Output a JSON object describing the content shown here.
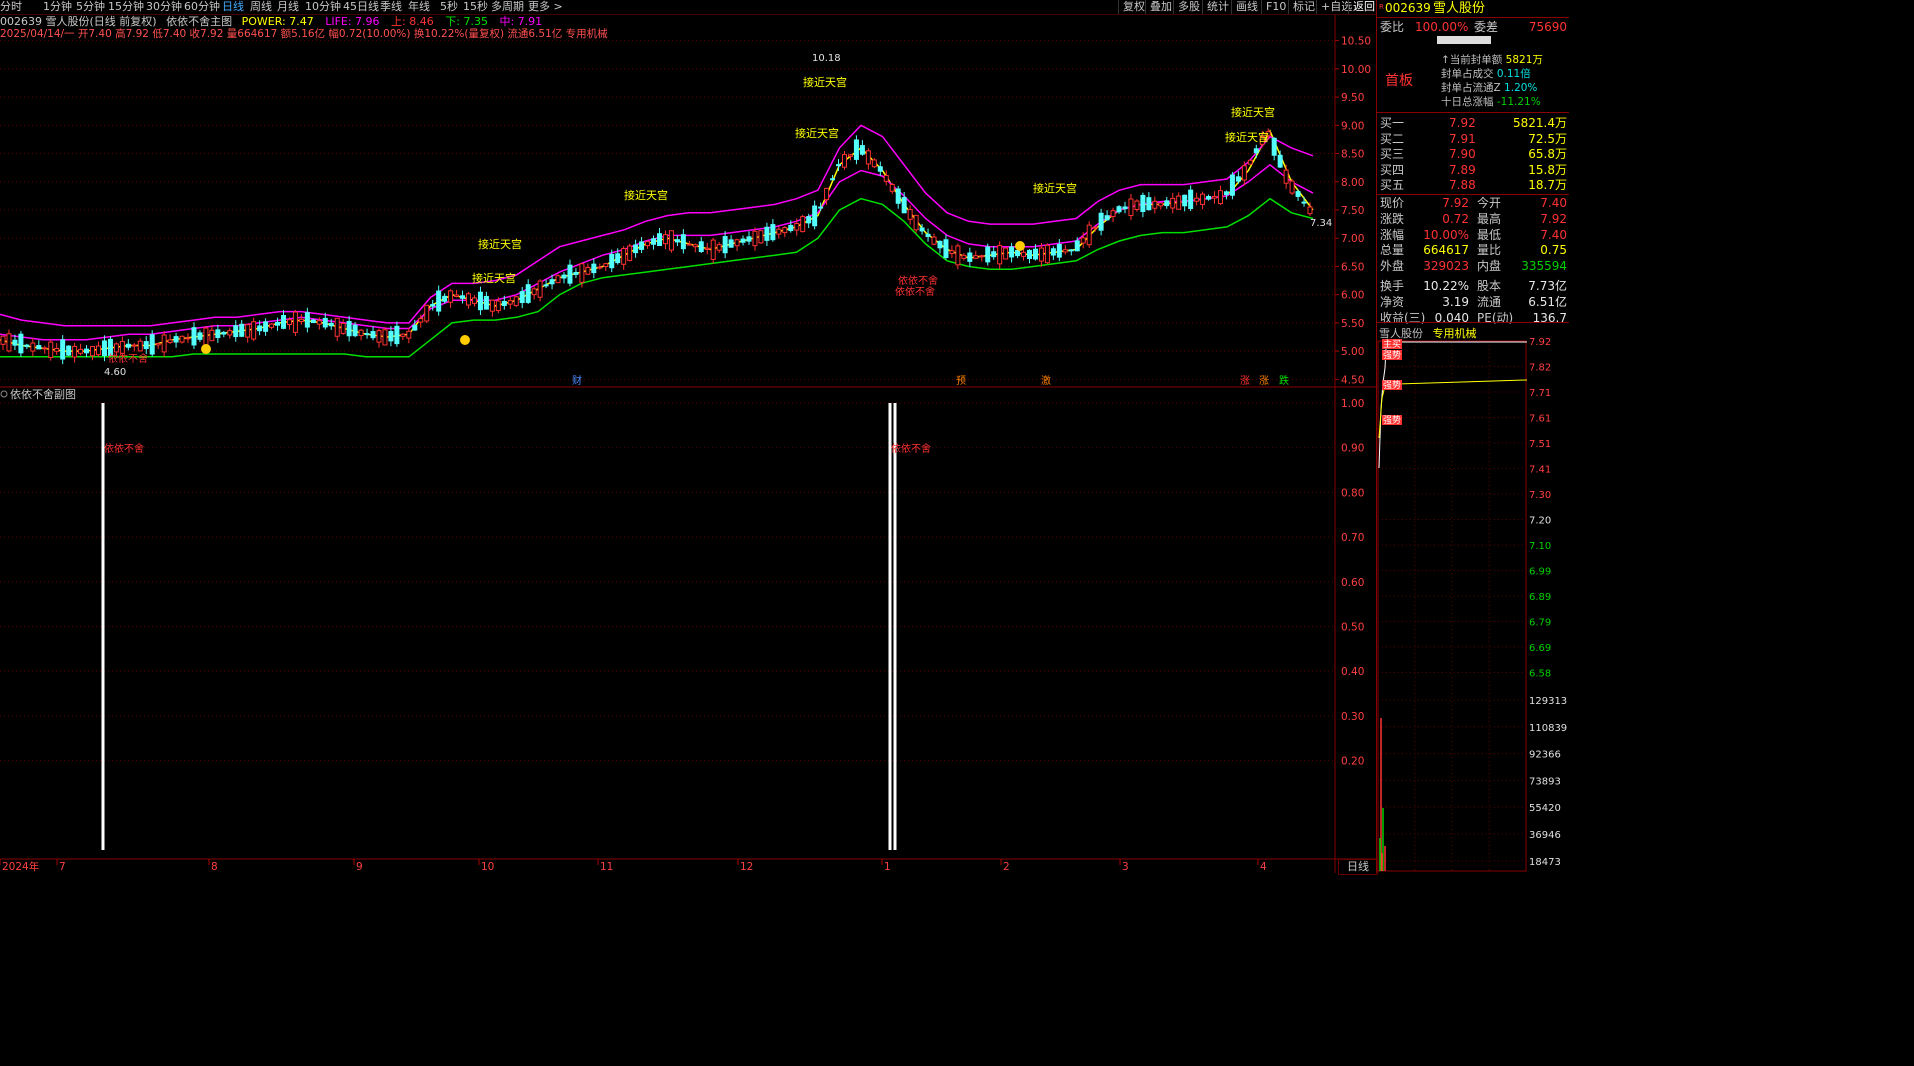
{
  "topbar": {
    "periods": [
      "分时",
      "1分钟",
      "5分钟",
      "15分钟",
      "30分钟",
      "60分钟",
      "日线",
      "周线",
      "月线",
      "10分钟",
      "45日线",
      "季线",
      "年线",
      "5秒",
      "15秒",
      "多周期",
      "更多 >"
    ],
    "selected": "日线",
    "tools": [
      "复权",
      "叠加",
      "多股",
      "统计",
      "画线",
      "F10",
      "标记",
      "+自选",
      "返回"
    ]
  },
  "header": {
    "stock_title": "002639 雪人股份(日线 前复权)",
    "indicator_name": "依依不舍主图",
    "power": "POWER: 7.47",
    "life": "LIFE: 7.96",
    "up": "上: 8.46",
    "down": "下: 7.35",
    "mid": "中: 7.91",
    "bar_info": "2025/04/14/一 开7.40 高7.92 低7.40 收7.92 量664617 额5.16亿 幅0.72(10.00%) 换10.22%(量复权) 流通6.51亿 专用机械"
  },
  "colors": {
    "up": "#ff3232",
    "down": "#54ffff",
    "power": "#ffff00",
    "life": "#ff00ff",
    "upper": "#ff00ff",
    "lower": "#00e000",
    "accent": "#ff3232"
  },
  "chart_data": [
    {
      "type": "candlestick",
      "title": "依依不舍主图",
      "x_labels": [
        "2024年",
        "7",
        "8",
        "9",
        "10",
        "11",
        "12",
        "1",
        "2",
        "3",
        "4"
      ],
      "y_ticks": [
        "10.50",
        "10.00",
        "9.50",
        "9.00",
        "8.50",
        "8.00",
        "7.50",
        "7.00",
        "6.50",
        "6.00",
        "5.50",
        "5.00",
        "4.50"
      ],
      "ylim": [
        4.4,
        10.6
      ],
      "annotations": [
        "10.18",
        "4.60",
        "7.34",
        "接近天宫",
        "依依不舍",
        "财",
        "预",
        "激",
        "涨",
        "跌"
      ],
      "series": [
        {
          "name": "POWER",
          "values": [
            5.2,
            5.1,
            5.05,
            5.0,
            5.0,
            5.05,
            5.1,
            5.1,
            5.2,
            5.25,
            5.3,
            5.35,
            5.4,
            5.5,
            5.55,
            5.5,
            5.4,
            5.3,
            5.25,
            5.3,
            5.8,
            6.0,
            5.9,
            5.8,
            5.9,
            6.1,
            6.3,
            6.4,
            6.5,
            6.7,
            6.9,
            7.0,
            6.9,
            6.8,
            6.9,
            7.0,
            7.1,
            7.2,
            7.4,
            8.3,
            8.6,
            8.2,
            7.6,
            7.1,
            6.8,
            6.65,
            6.7,
            6.75,
            6.7,
            6.75,
            6.8,
            7.2,
            7.5,
            7.6,
            7.6,
            7.65,
            7.7,
            7.75,
            8.2,
            8.9,
            8.0,
            7.5
          ]
        },
        {
          "name": "LIFE",
          "values": [
            5.3,
            5.25,
            5.2,
            5.2,
            5.2,
            5.25,
            5.3,
            5.3,
            5.35,
            5.4,
            5.45,
            5.45,
            5.5,
            5.55,
            5.6,
            5.55,
            5.5,
            5.45,
            5.4,
            5.4,
            5.75,
            5.9,
            5.9,
            5.9,
            6.0,
            6.2,
            6.4,
            6.55,
            6.7,
            6.8,
            6.95,
            7.05,
            7.05,
            7.05,
            7.1,
            7.15,
            7.2,
            7.3,
            7.45,
            8.0,
            8.2,
            8.1,
            7.75,
            7.35,
            7.05,
            6.9,
            6.85,
            6.85,
            6.85,
            6.9,
            6.95,
            7.25,
            7.5,
            7.6,
            7.65,
            7.65,
            7.7,
            7.75,
            8.0,
            8.3,
            8.0,
            7.8
          ]
        },
        {
          "name": "上",
          "values": [
            5.65,
            5.55,
            5.5,
            5.45,
            5.45,
            5.45,
            5.45,
            5.45,
            5.5,
            5.55,
            5.6,
            5.6,
            5.65,
            5.7,
            5.7,
            5.65,
            5.6,
            5.55,
            5.5,
            5.5,
            5.95,
            6.2,
            6.2,
            6.25,
            6.35,
            6.6,
            6.85,
            6.95,
            7.05,
            7.15,
            7.3,
            7.4,
            7.45,
            7.45,
            7.5,
            7.55,
            7.6,
            7.7,
            7.85,
            8.6,
            9.0,
            8.8,
            8.3,
            7.8,
            7.45,
            7.3,
            7.25,
            7.25,
            7.25,
            7.3,
            7.35,
            7.65,
            7.85,
            7.95,
            7.95,
            7.95,
            8.0,
            8.05,
            8.35,
            8.8,
            8.6,
            8.46
          ]
        },
        {
          "name": "下",
          "values": [
            4.9,
            4.9,
            4.9,
            4.9,
            4.9,
            4.9,
            4.9,
            4.9,
            4.9,
            4.95,
            4.95,
            4.95,
            4.95,
            4.95,
            4.95,
            4.95,
            4.95,
            4.9,
            4.9,
            4.9,
            5.2,
            5.5,
            5.55,
            5.55,
            5.6,
            5.7,
            6.0,
            6.2,
            6.3,
            6.35,
            6.4,
            6.45,
            6.5,
            6.55,
            6.6,
            6.65,
            6.7,
            6.75,
            7.0,
            7.5,
            7.7,
            7.6,
            7.3,
            6.9,
            6.6,
            6.5,
            6.45,
            6.45,
            6.5,
            6.55,
            6.6,
            6.8,
            6.95,
            7.05,
            7.1,
            7.1,
            7.15,
            7.2,
            7.4,
            7.7,
            7.45,
            7.35
          ]
        }
      ]
    },
    {
      "type": "bar",
      "title": "依依不舍副图",
      "y_ticks": [
        "1.00",
        "0.90",
        "0.80",
        "0.70",
        "0.60",
        "0.50",
        "0.40",
        "0.30",
        "0.20"
      ],
      "ylim": [
        0,
        1.0
      ],
      "signals": [
        "依依不舍",
        "依依不舍"
      ],
      "values": [
        1,
        1,
        1
      ]
    }
  ],
  "right_panel": {
    "code": "002639",
    "name": "雪人股份",
    "weibi_label": "委比",
    "weibi": "100.00%",
    "weicha_label": "委差",
    "weicha": "75690",
    "board": "首板",
    "seal_lines": [
      {
        "label": "↑当前封单额",
        "value": "5821万"
      },
      {
        "label": "封单占成交",
        "value": "0.11倍"
      },
      {
        "label": "封单占流通Z",
        "value": "1.20%"
      },
      {
        "label": "十日总涨幅",
        "value": "-11.21%"
      }
    ],
    "bids": [
      {
        "label": "买一",
        "price": "7.92",
        "vol": "5821.4万"
      },
      {
        "label": "买二",
        "price": "7.91",
        "vol": "72.5万"
      },
      {
        "label": "买三",
        "price": "7.90",
        "vol": "65.8万"
      },
      {
        "label": "买四",
        "price": "7.89",
        "vol": "15.8万"
      },
      {
        "label": "买五",
        "price": "7.88",
        "vol": "18.7万"
      }
    ],
    "quotes": [
      {
        "l": "现价",
        "v": "7.92",
        "l2": "今开",
        "v2": "7.40"
      },
      {
        "l": "涨跌",
        "v": "0.72",
        "l2": "最高",
        "v2": "7.92"
      },
      {
        "l": "涨幅",
        "v": "10.00%",
        "l2": "最低",
        "v2": "7.40"
      },
      {
        "l": "总量",
        "v": "664617",
        "l2": "量比",
        "v2": "0.75"
      },
      {
        "l": "外盘",
        "v": "329023",
        "l2": "内盘",
        "v2": "335594"
      },
      {
        "l": "换手",
        "v": "10.22%",
        "l2": "股本",
        "v2": "7.73亿"
      },
      {
        "l": "净资",
        "v": "3.19",
        "l2": "流通",
        "v2": "6.51亿"
      },
      {
        "l": "收益(三)",
        "v": "0.040",
        "l2": "PE(动)",
        "v2": "136.7"
      }
    ],
    "mini_title": "雪人股份",
    "mini_sector": "专用机械",
    "mini_tags": [
      "主买",
      "强势",
      "强势",
      "强势"
    ],
    "mini_price_ticks": [
      "7.92",
      "7.82",
      "7.71",
      "7.61",
      "7.51",
      "7.41",
      "7.30",
      "7.20",
      "7.10",
      "6.99",
      "6.89",
      "6.79",
      "6.69",
      "6.58"
    ],
    "mini_vol_ticks": [
      "129313",
      "110839",
      "92366",
      "73893",
      "55420",
      "36946",
      "18473"
    ]
  },
  "footer": {
    "period_label": "日线"
  }
}
